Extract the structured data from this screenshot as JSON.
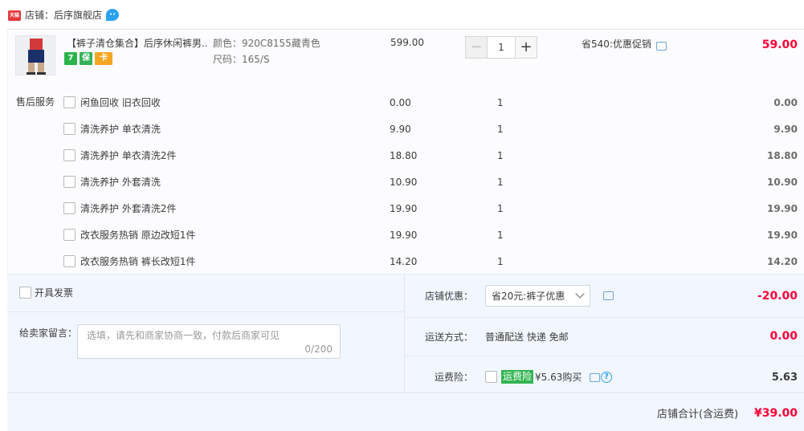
{
  "shop": {
    "badge": "天猫",
    "label": "店铺：后序旗舰店"
  },
  "item": {
    "title": "【裤子清仓集合】后序休闲裤男...",
    "color": "颜色：920C8155藏青色",
    "size": "尺码：165/S",
    "price": "599.00",
    "quantity": "1",
    "promo": "省540:优惠促销",
    "subtotal": "59.00",
    "service_icons": [
      "7",
      "保",
      "卡"
    ]
  },
  "after_sales": {
    "label": "售后服务",
    "services": [
      {
        "name": "闲鱼回收 旧衣回收",
        "price": "0.00",
        "qty": "1",
        "total": "0.00"
      },
      {
        "name": "清洗养护 单衣清洗",
        "price": "9.90",
        "qty": "1",
        "total": "9.90"
      },
      {
        "name": "清洗养护 单衣清洗2件",
        "price": "18.80",
        "qty": "1",
        "total": "18.80"
      },
      {
        "name": "清洗养护 外套清洗",
        "price": "10.90",
        "qty": "1",
        "total": "10.90"
      },
      {
        "name": "清洗养护 外套清洗2件",
        "price": "19.90",
        "qty": "1",
        "total": "19.90"
      },
      {
        "name": "改衣服务热销 原边改短1件",
        "price": "19.90",
        "qty": "1",
        "total": "19.90"
      },
      {
        "name": "改衣服务热销 裤长改短1件",
        "price": "14.20",
        "qty": "1",
        "total": "14.20"
      }
    ]
  },
  "invoice": {
    "label": "开具发票"
  },
  "message": {
    "label": "给卖家留言：",
    "placeholder": "选填，请先和商家协商一致，付款后商家可见",
    "count": "0/200"
  },
  "shop_discount": {
    "label": "店铺优惠：",
    "selected": "省20元:裤子优惠",
    "amount": "-20.00"
  },
  "shipping": {
    "label": "运送方式：",
    "value": "普通配送 快递 免邮",
    "amount": "0.00"
  },
  "insurance": {
    "label": "运费险：",
    "tag": "运费险",
    "price": "¥5.63购买",
    "amount": "5.63"
  },
  "total": {
    "label": "店铺合计(含运费)",
    "amount": "¥39.00"
  },
  "colors": {
    "price_red": "#ff0036",
    "tmall_red": "#e4393c",
    "insurance_green": "#33b552",
    "footer_bg": "#f2f7ff"
  }
}
